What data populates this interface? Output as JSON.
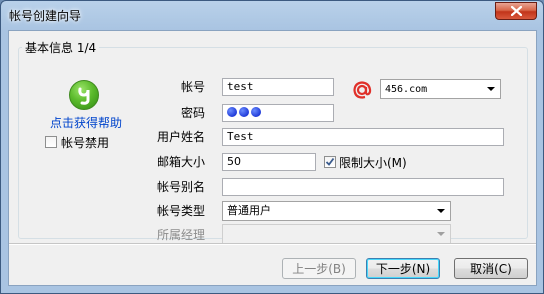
{
  "window": {
    "title": "帐号创建向导"
  },
  "group": {
    "legend": "基本信息 1/4"
  },
  "sidebar": {
    "help_link": "点击获得帮助",
    "disable_account_label": "帐号禁用",
    "disable_account_checked": false
  },
  "form": {
    "account_label": "帐号",
    "account_value": "test",
    "domain_value": "456.com",
    "password_label": "密码",
    "password_dot_count": 3,
    "username_label": "用户姓名",
    "username_value": "Test",
    "mailbox_size_label": "邮箱大小",
    "mailbox_size_value": "50",
    "limit_size_label": "限制大小(M)",
    "limit_size_checked": true,
    "alias_label": "帐号别名",
    "alias_value": "",
    "account_type_label": "帐号类型",
    "account_type_value": "普通用户",
    "manager_label": "所属经理",
    "manager_value": ""
  },
  "buttons": {
    "prev": "上一步(B)",
    "next": "下一步(N)",
    "cancel": "取消(C)"
  },
  "icons": {
    "close": "close-icon",
    "logo": "app-logo-icon",
    "at": "at-sign-icon"
  },
  "colors": {
    "link": "#0044cc",
    "at_icon": "#e0302a",
    "close_button": "#c2341a"
  }
}
